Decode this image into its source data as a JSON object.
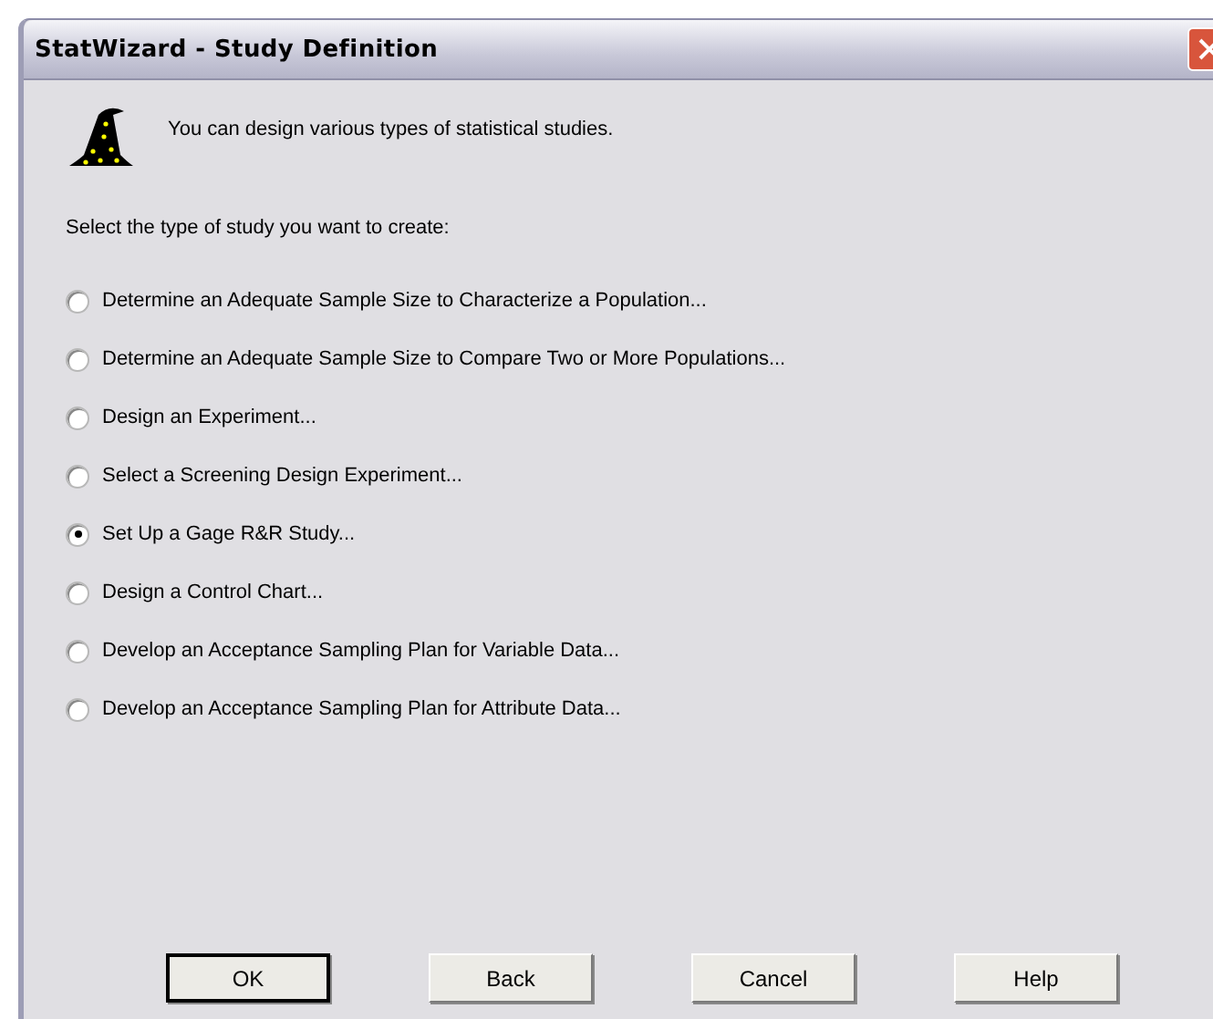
{
  "window": {
    "title": "StatWizard - Study Definition"
  },
  "intro": "You can design various types of statistical studies.",
  "prompt": "Select the type of study you want to create:",
  "options": [
    {
      "label": "Determine an Adequate Sample Size to Characterize a Population...",
      "selected": false
    },
    {
      "label": "Determine an Adequate Sample Size to Compare Two or More Populations...",
      "selected": false
    },
    {
      "label": "Design an Experiment...",
      "selected": false
    },
    {
      "label": "Select a Screening Design Experiment...",
      "selected": false
    },
    {
      "label": "Set Up a Gage R&R Study...",
      "selected": true
    },
    {
      "label": "Design a Control Chart...",
      "selected": false
    },
    {
      "label": "Develop an Acceptance Sampling Plan for Variable Data...",
      "selected": false
    },
    {
      "label": "Develop an Acceptance Sampling Plan for Attribute Data...",
      "selected": false
    }
  ],
  "buttons": [
    {
      "label": "OK",
      "default": true
    },
    {
      "label": "Back",
      "default": false
    },
    {
      "label": "Cancel",
      "default": false
    },
    {
      "label": "Help",
      "default": false
    }
  ]
}
